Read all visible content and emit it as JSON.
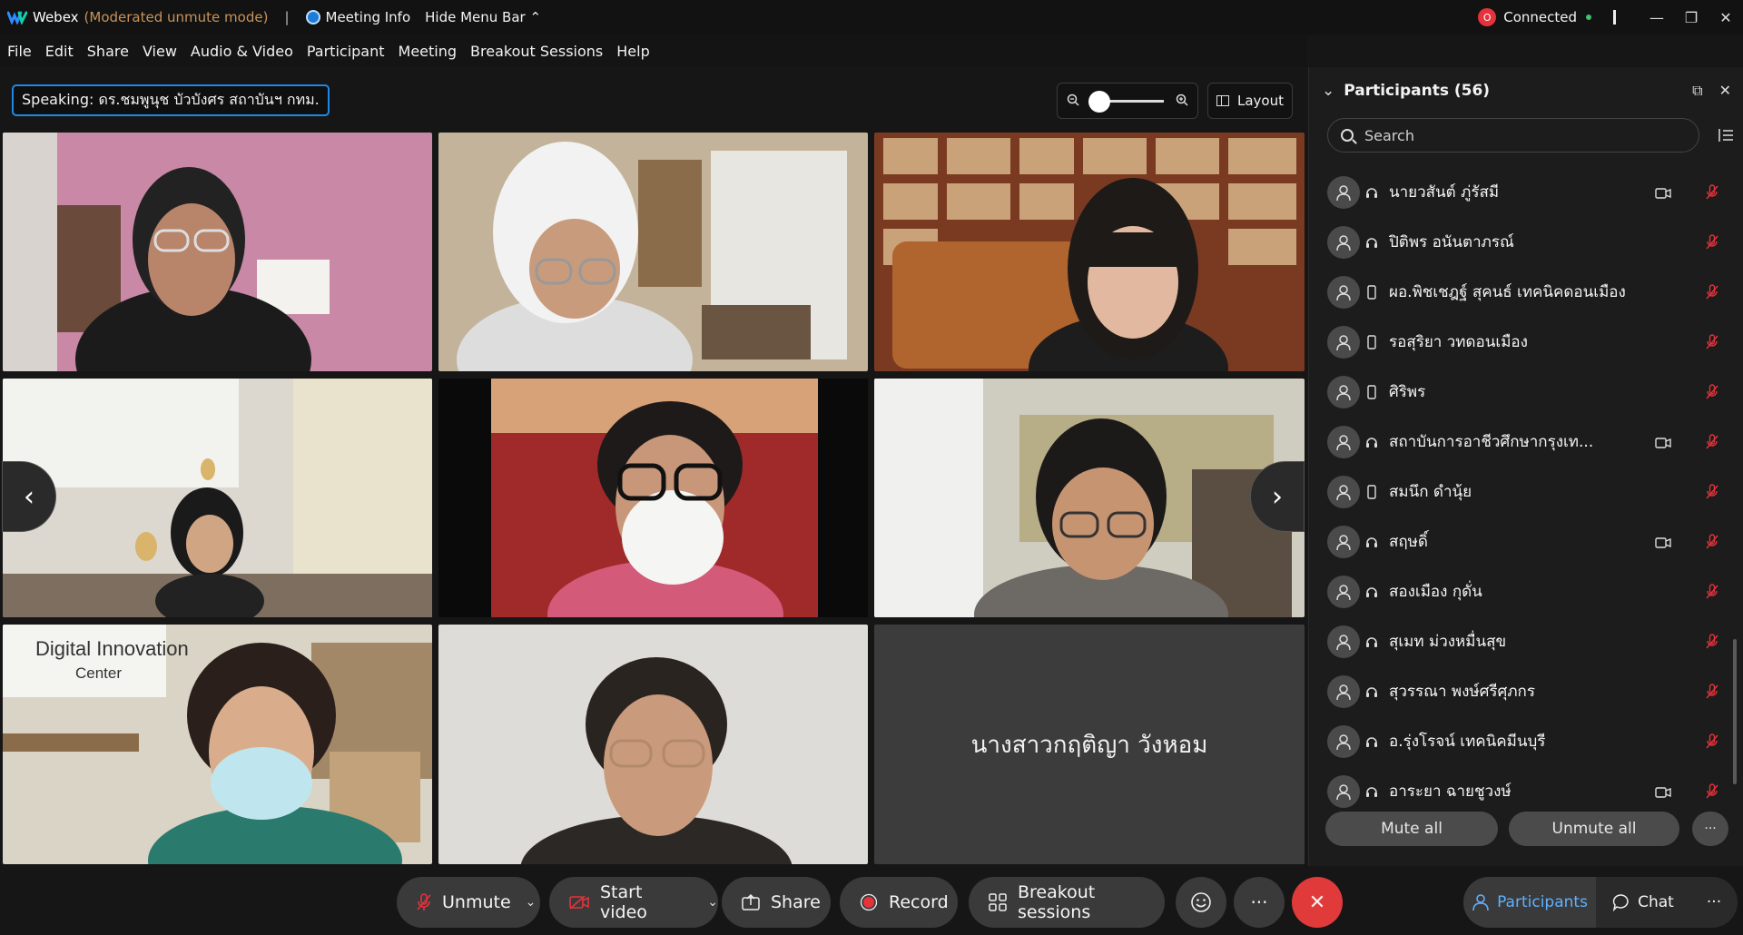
{
  "titlebar": {
    "app_name": "Webex",
    "mode": "(Moderated unmute mode)",
    "separator": "|",
    "meeting_info": "Meeting Info",
    "hide_menu": "Hide Menu Bar",
    "connection_status": "Connected",
    "connection_badge": "O"
  },
  "menu": [
    "File",
    "Edit",
    "Share",
    "View",
    "Audio & Video",
    "Participant",
    "Meeting",
    "Breakout Sessions",
    "Help"
  ],
  "speaking": "Speaking: ดร.ชมพูนุช บัวบังศร สถาบันฯ กทม.",
  "layout_label": "Layout",
  "video_tiles": [
    {
      "kind": "video",
      "bg": "#c58aa6"
    },
    {
      "kind": "video",
      "bg": "#b9a88c"
    },
    {
      "kind": "video",
      "bg": "#8a4a2c"
    },
    {
      "kind": "video",
      "bg": "#d8d4cc"
    },
    {
      "kind": "video",
      "bg": "#9e2a2a"
    },
    {
      "kind": "video",
      "bg": "#cfcdc0"
    },
    {
      "kind": "video",
      "bg": "#d9d5c8"
    },
    {
      "kind": "video",
      "bg": "#dcdad6"
    },
    {
      "kind": "name",
      "name": "นางสาวกฤติญา วังหอม"
    }
  ],
  "tile_text": {
    "digital_innovation": "Digital Innovation",
    "center": "Center"
  },
  "participants_panel": {
    "title": "Participants (56)",
    "search_placeholder": "Search",
    "mute_all": "Mute all",
    "unmute_all": "Unmute all",
    "participants": [
      {
        "name": "นายวสันต์ ภู่รัสมี",
        "device": "headset",
        "camera": true
      },
      {
        "name": "ปิติพร อนันตาภรณ์",
        "device": "headset",
        "camera": false
      },
      {
        "name": "ผอ.พิชเชฎฐ์ สุคนธ์ เทคนิคดอนเมือง",
        "device": "phone",
        "camera": false
      },
      {
        "name": "รอสุริยา วทดอนเมือง",
        "device": "phone",
        "camera": false
      },
      {
        "name": "ศิริพร",
        "device": "phone",
        "camera": false
      },
      {
        "name": "สถาบันการอาชีวศึกษากรุงเท...",
        "device": "headset",
        "camera": true
      },
      {
        "name": "สมนึก ดำนุ้ย",
        "device": "phone",
        "camera": false
      },
      {
        "name": "สฤษดิ์",
        "device": "headset",
        "camera": true
      },
      {
        "name": "สองเมือง กุดั่น",
        "device": "headset",
        "camera": false
      },
      {
        "name": "สุเมท ม่วงหมื่นสุข",
        "device": "headset",
        "camera": false
      },
      {
        "name": "สุวรรณา พงษ์ศรีศุภกร",
        "device": "headset",
        "camera": false
      },
      {
        "name": "อ.รุ่งโรจน์ เทคนิคมีนบุรี",
        "device": "headset",
        "camera": false
      },
      {
        "name": "อาระยา ฉายชูวงษ์",
        "device": "headset",
        "camera": true
      }
    ]
  },
  "toolbar": {
    "unmute": "Unmute",
    "start_video": "Start video",
    "share": "Share",
    "record": "Record",
    "breakout": "Breakout sessions",
    "more": "···",
    "participants": "Participants",
    "chat": "Chat"
  },
  "colors": {
    "accent_blue": "#1f87e6",
    "end_red": "#e13a3a",
    "mute_red": "#e5323b",
    "participants_active": "#5fb0ff"
  }
}
